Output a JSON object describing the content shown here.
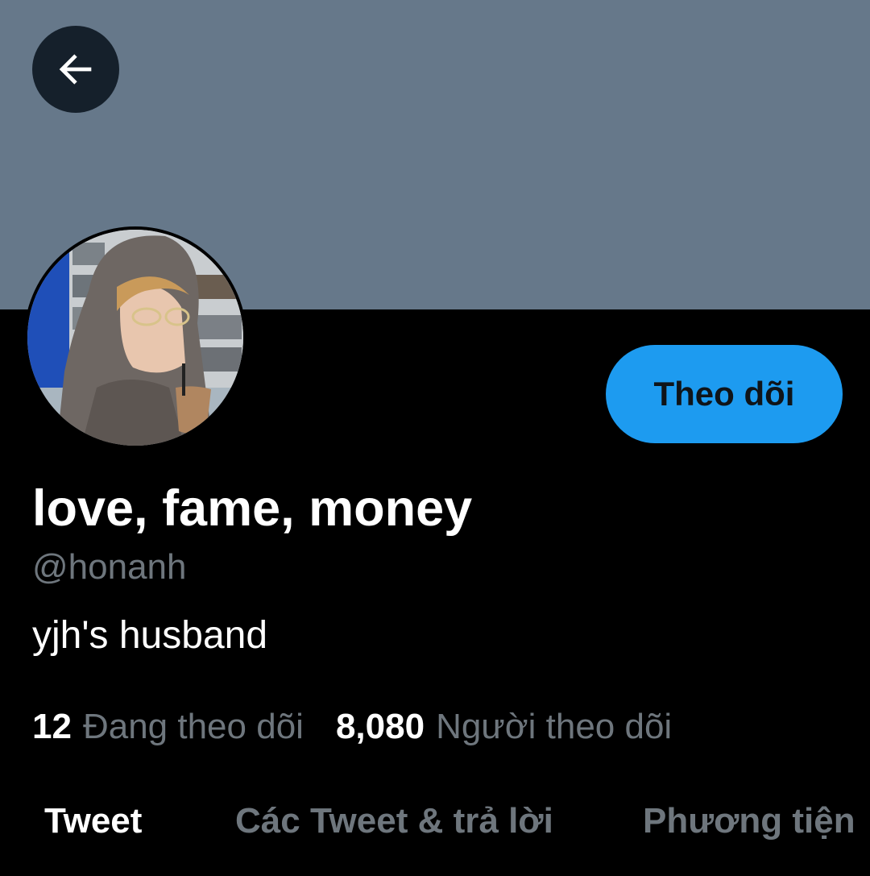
{
  "header": {
    "back_icon": "arrow-left-icon",
    "banner_color": "#66788a"
  },
  "profile": {
    "display_name": "love, fame, money",
    "handle": "@honanh",
    "bio": "yjh's husband",
    "follow_label": "Theo dõi",
    "accent_color": "#1d9bf0",
    "stats": {
      "following_count": "12",
      "following_label": "Đang theo dõi",
      "followers_count": "8,080",
      "followers_label": "Người theo dõi"
    }
  },
  "tabs": [
    {
      "label": "Tweet",
      "active": true
    },
    {
      "label": "Các Tweet & trả lời",
      "active": false
    },
    {
      "label": "Phương tiện",
      "active": false
    }
  ]
}
